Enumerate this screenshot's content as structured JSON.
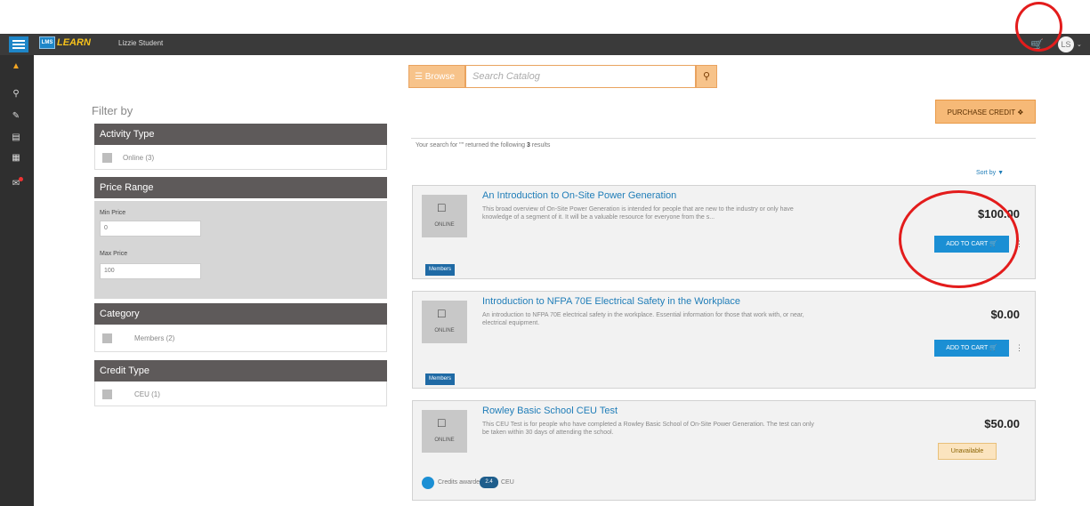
{
  "topbar": {
    "logo_mark": "LMS",
    "logo_text": "LEARN",
    "username": "Lizzie Student",
    "cart_icon": "cart-icon",
    "avatar_initials": "LS",
    "avatar_caret": "⌄"
  },
  "sidenav": {
    "items": [
      "home-icon",
      "search-icon",
      "edit-icon",
      "catalog-icon",
      "calendar-icon",
      "messages-icon"
    ]
  },
  "search": {
    "browse_label": "Browse",
    "placeholder": "Search Catalog"
  },
  "filters": {
    "title": "Filter by",
    "activity_type": {
      "heading": "Activity Type",
      "options": [
        "Online (3)"
      ]
    },
    "price_range": {
      "heading": "Price Range",
      "min_label": "Min Price",
      "min_value": "0",
      "max_label": "Max Price",
      "max_value": "100"
    },
    "category": {
      "heading": "Category",
      "options": [
        "Members (2)"
      ]
    },
    "credit_type": {
      "heading": "Credit Type",
      "options": [
        "CEU (1)"
      ]
    }
  },
  "results": {
    "purchase_credit_label": "PURCHASE CREDIT",
    "summary_prefix": "Your search for \"\" returned the following ",
    "summary_count": "3",
    "summary_suffix": " results",
    "sort_label": "Sort by",
    "items": [
      {
        "format": "ONLINE",
        "title": "An Introduction to On-Site Power Generation",
        "description": "This broad overview of On-Site Power Generation is intended for people that are new to the industry or only have knowledge of a segment of it.  It will be a valuable resource for everyone from the s...",
        "price": "$100.00",
        "action_label": "ADD TO CART",
        "tag": "Members"
      },
      {
        "format": "ONLINE",
        "title": "Introduction to NFPA 70E Electrical Safety in the Workplace",
        "description": "An introduction to NFPA 70E electrical safety in the workplace. Essential information for those that work with, or near, electrical equipment.",
        "price": "$0.00",
        "action_label": "ADD TO CART",
        "tag": "Members"
      },
      {
        "format": "ONLINE",
        "title": "Rowley Basic School CEU Test",
        "description": "This CEU Test is for people who have completed a Rowley Basic School of On-Site Power Generation. The test can only be taken within 30 days of attending the school.",
        "price": "$50.00",
        "status": "Unavailable",
        "credits_label": "Credits awarded",
        "credits_value": "2.4",
        "credits_unit": "CEU"
      }
    ]
  },
  "colors": {
    "accent": "#1b8fd4",
    "brand_orange": "#f7c38a",
    "annotation_red": "#e31c1c"
  }
}
